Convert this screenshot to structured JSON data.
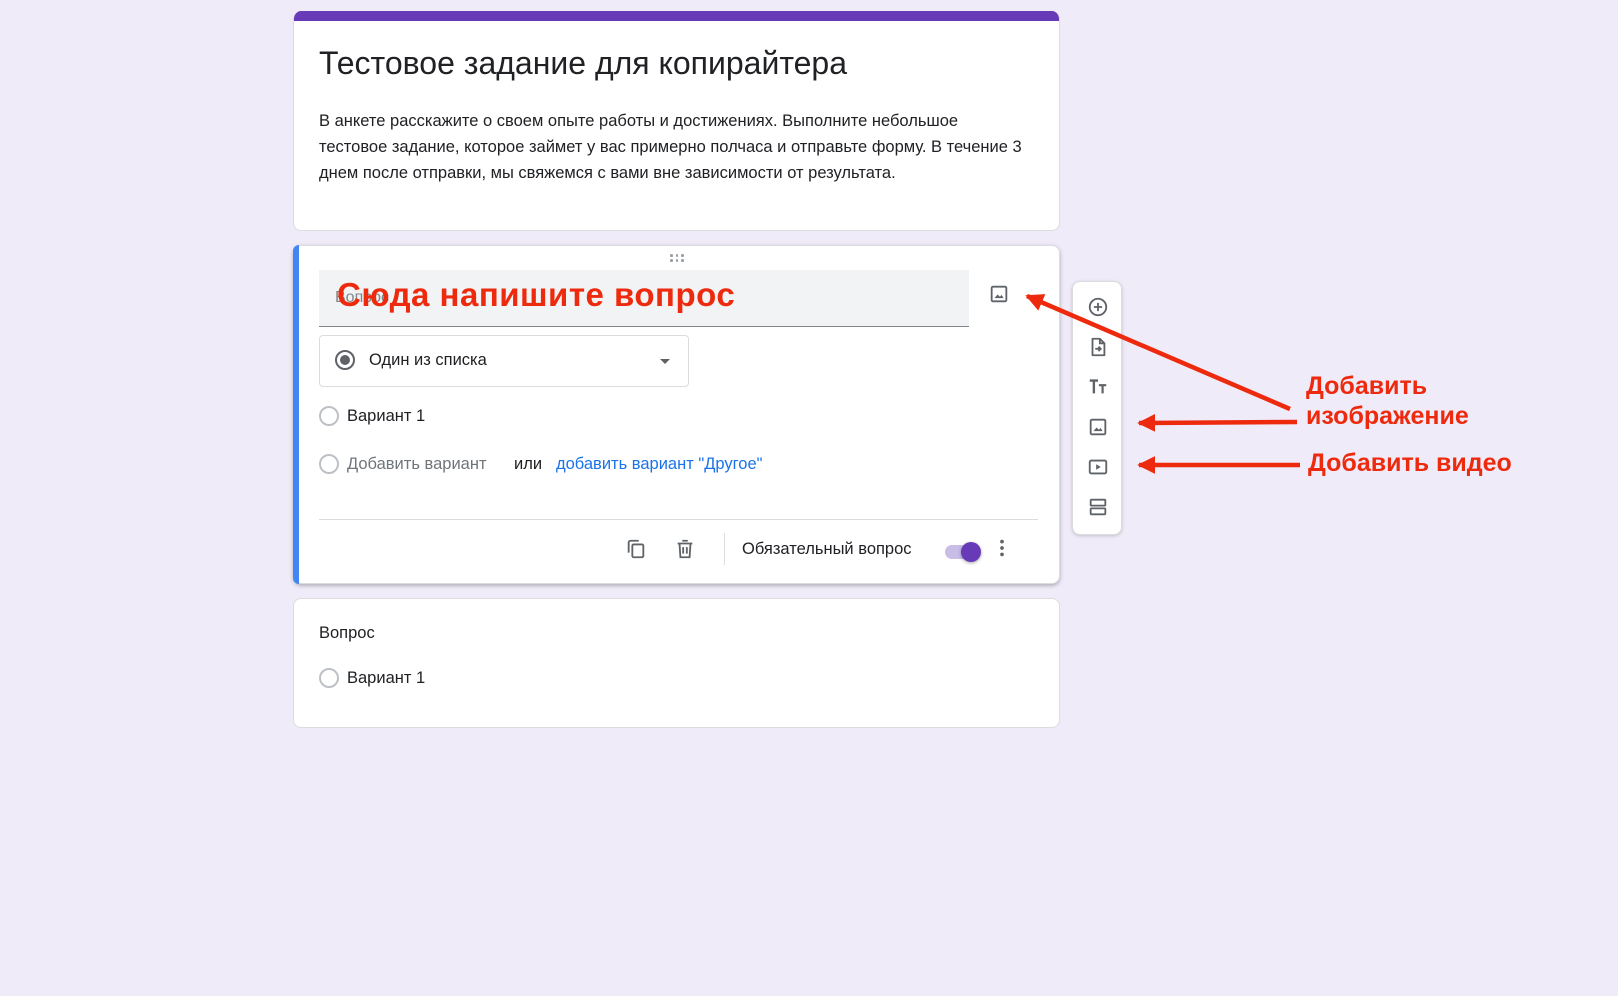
{
  "form": {
    "title": "Тестовое задание для копирайтера",
    "description": "В анкете расскажите о своем опыте работы и достижениях. Выполните небольшое тестовое задание, которое займет у вас примерно полчаса и отправьте форму. В течение 3 днем после отправки, мы свяжемся с вами вне зависимости от результата."
  },
  "active_question": {
    "placeholder": "Вопрос",
    "type_label": "Один из списка",
    "options": [
      "Вариант 1"
    ],
    "add_option_label": "Добавить вариант",
    "or_label": "или",
    "add_other_label": "добавить вариант \"Другое\"",
    "required_label": "Обязательный вопрос",
    "required_on": true
  },
  "second_question": {
    "title": "Вопрос",
    "options": [
      "Вариант 1"
    ]
  },
  "toolbar": {
    "icons": [
      "add-question-icon",
      "import-questions-icon",
      "add-title-text-icon",
      "add-image-icon",
      "add-video-icon",
      "add-section-icon"
    ]
  },
  "annotations": {
    "write_question": "Сюда напишите вопрос",
    "add_image_line1": "Добавить",
    "add_image_line2": "изображение",
    "add_video": "Добавить видео"
  },
  "colors": {
    "background": "#f0ebf8",
    "accent": "#673ab7",
    "active_border": "#4285f4",
    "link": "#1a73e8",
    "annotation": "#ee2a0e"
  }
}
